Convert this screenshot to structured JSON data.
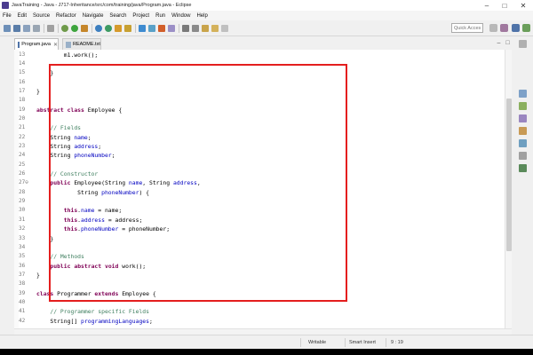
{
  "window": {
    "title": "JavaTraining - Java - J717-Inheritance/src/com/training/java/Program.java - Eclipse",
    "controls": {
      "minimize": "–",
      "maximize": "□",
      "close": "✕"
    }
  },
  "menu": [
    "File",
    "Edit",
    "Source",
    "Refactor",
    "Navigate",
    "Search",
    "Project",
    "Run",
    "Window",
    "Help"
  ],
  "toolbar": {
    "quick_access_placeholder": "Quick Access"
  },
  "tabs": [
    {
      "label": "Program.java",
      "close": "✕"
    },
    {
      "label": "README.txt",
      "close": ""
    }
  ],
  "tab_controls": {
    "minimize": "–",
    "maximize": "□"
  },
  "editor": {
    "lines": [
      {
        "num": "13",
        "code": "        m1.work();"
      },
      {
        "num": "14",
        "code": ""
      },
      {
        "num": "15",
        "code": "    }"
      },
      {
        "num": "16",
        "code": ""
      },
      {
        "num": "17",
        "code": "}"
      },
      {
        "num": "18",
        "code": ""
      },
      {
        "num": "19",
        "code": "abstract class Employee {"
      },
      {
        "num": "20",
        "code": ""
      },
      {
        "num": "21",
        "code": "    // Fields"
      },
      {
        "num": "22",
        "code": "    String name;"
      },
      {
        "num": "23",
        "code": "    String address;"
      },
      {
        "num": "24",
        "code": "    String phoneNumber;"
      },
      {
        "num": "25",
        "code": ""
      },
      {
        "num": "26",
        "code": "    // Constructor"
      },
      {
        "num": "27⊖",
        "code": "    public Employee(String name, String address,"
      },
      {
        "num": "28",
        "code": "            String phoneNumber) {"
      },
      {
        "num": "29",
        "code": ""
      },
      {
        "num": "30",
        "code": "        this.name = name;"
      },
      {
        "num": "31",
        "code": "        this.address = address;"
      },
      {
        "num": "32",
        "code": "        this.phoneNumber = phoneNumber;"
      },
      {
        "num": "33",
        "code": "    }"
      },
      {
        "num": "34",
        "code": ""
      },
      {
        "num": "35",
        "code": "    // Methods"
      },
      {
        "num": "36",
        "code": "    public abstract void work();"
      },
      {
        "num": "37",
        "code": "}"
      },
      {
        "num": "38",
        "code": ""
      },
      {
        "num": "39",
        "code": "class Programmer extends Employee {"
      },
      {
        "num": "40",
        "code": ""
      },
      {
        "num": "41",
        "code": "    // Programmer specific Fields"
      },
      {
        "num": "42",
        "code": "    String[] programmingLanguages;"
      }
    ]
  },
  "status": {
    "mode": "Writable",
    "insert": "Smart Insert",
    "position": "9 : 19"
  },
  "colors": {
    "highlight": "#e41e1e",
    "keyword": "#7f0055",
    "comment": "#3f7f5f",
    "field": "#0000c0"
  }
}
